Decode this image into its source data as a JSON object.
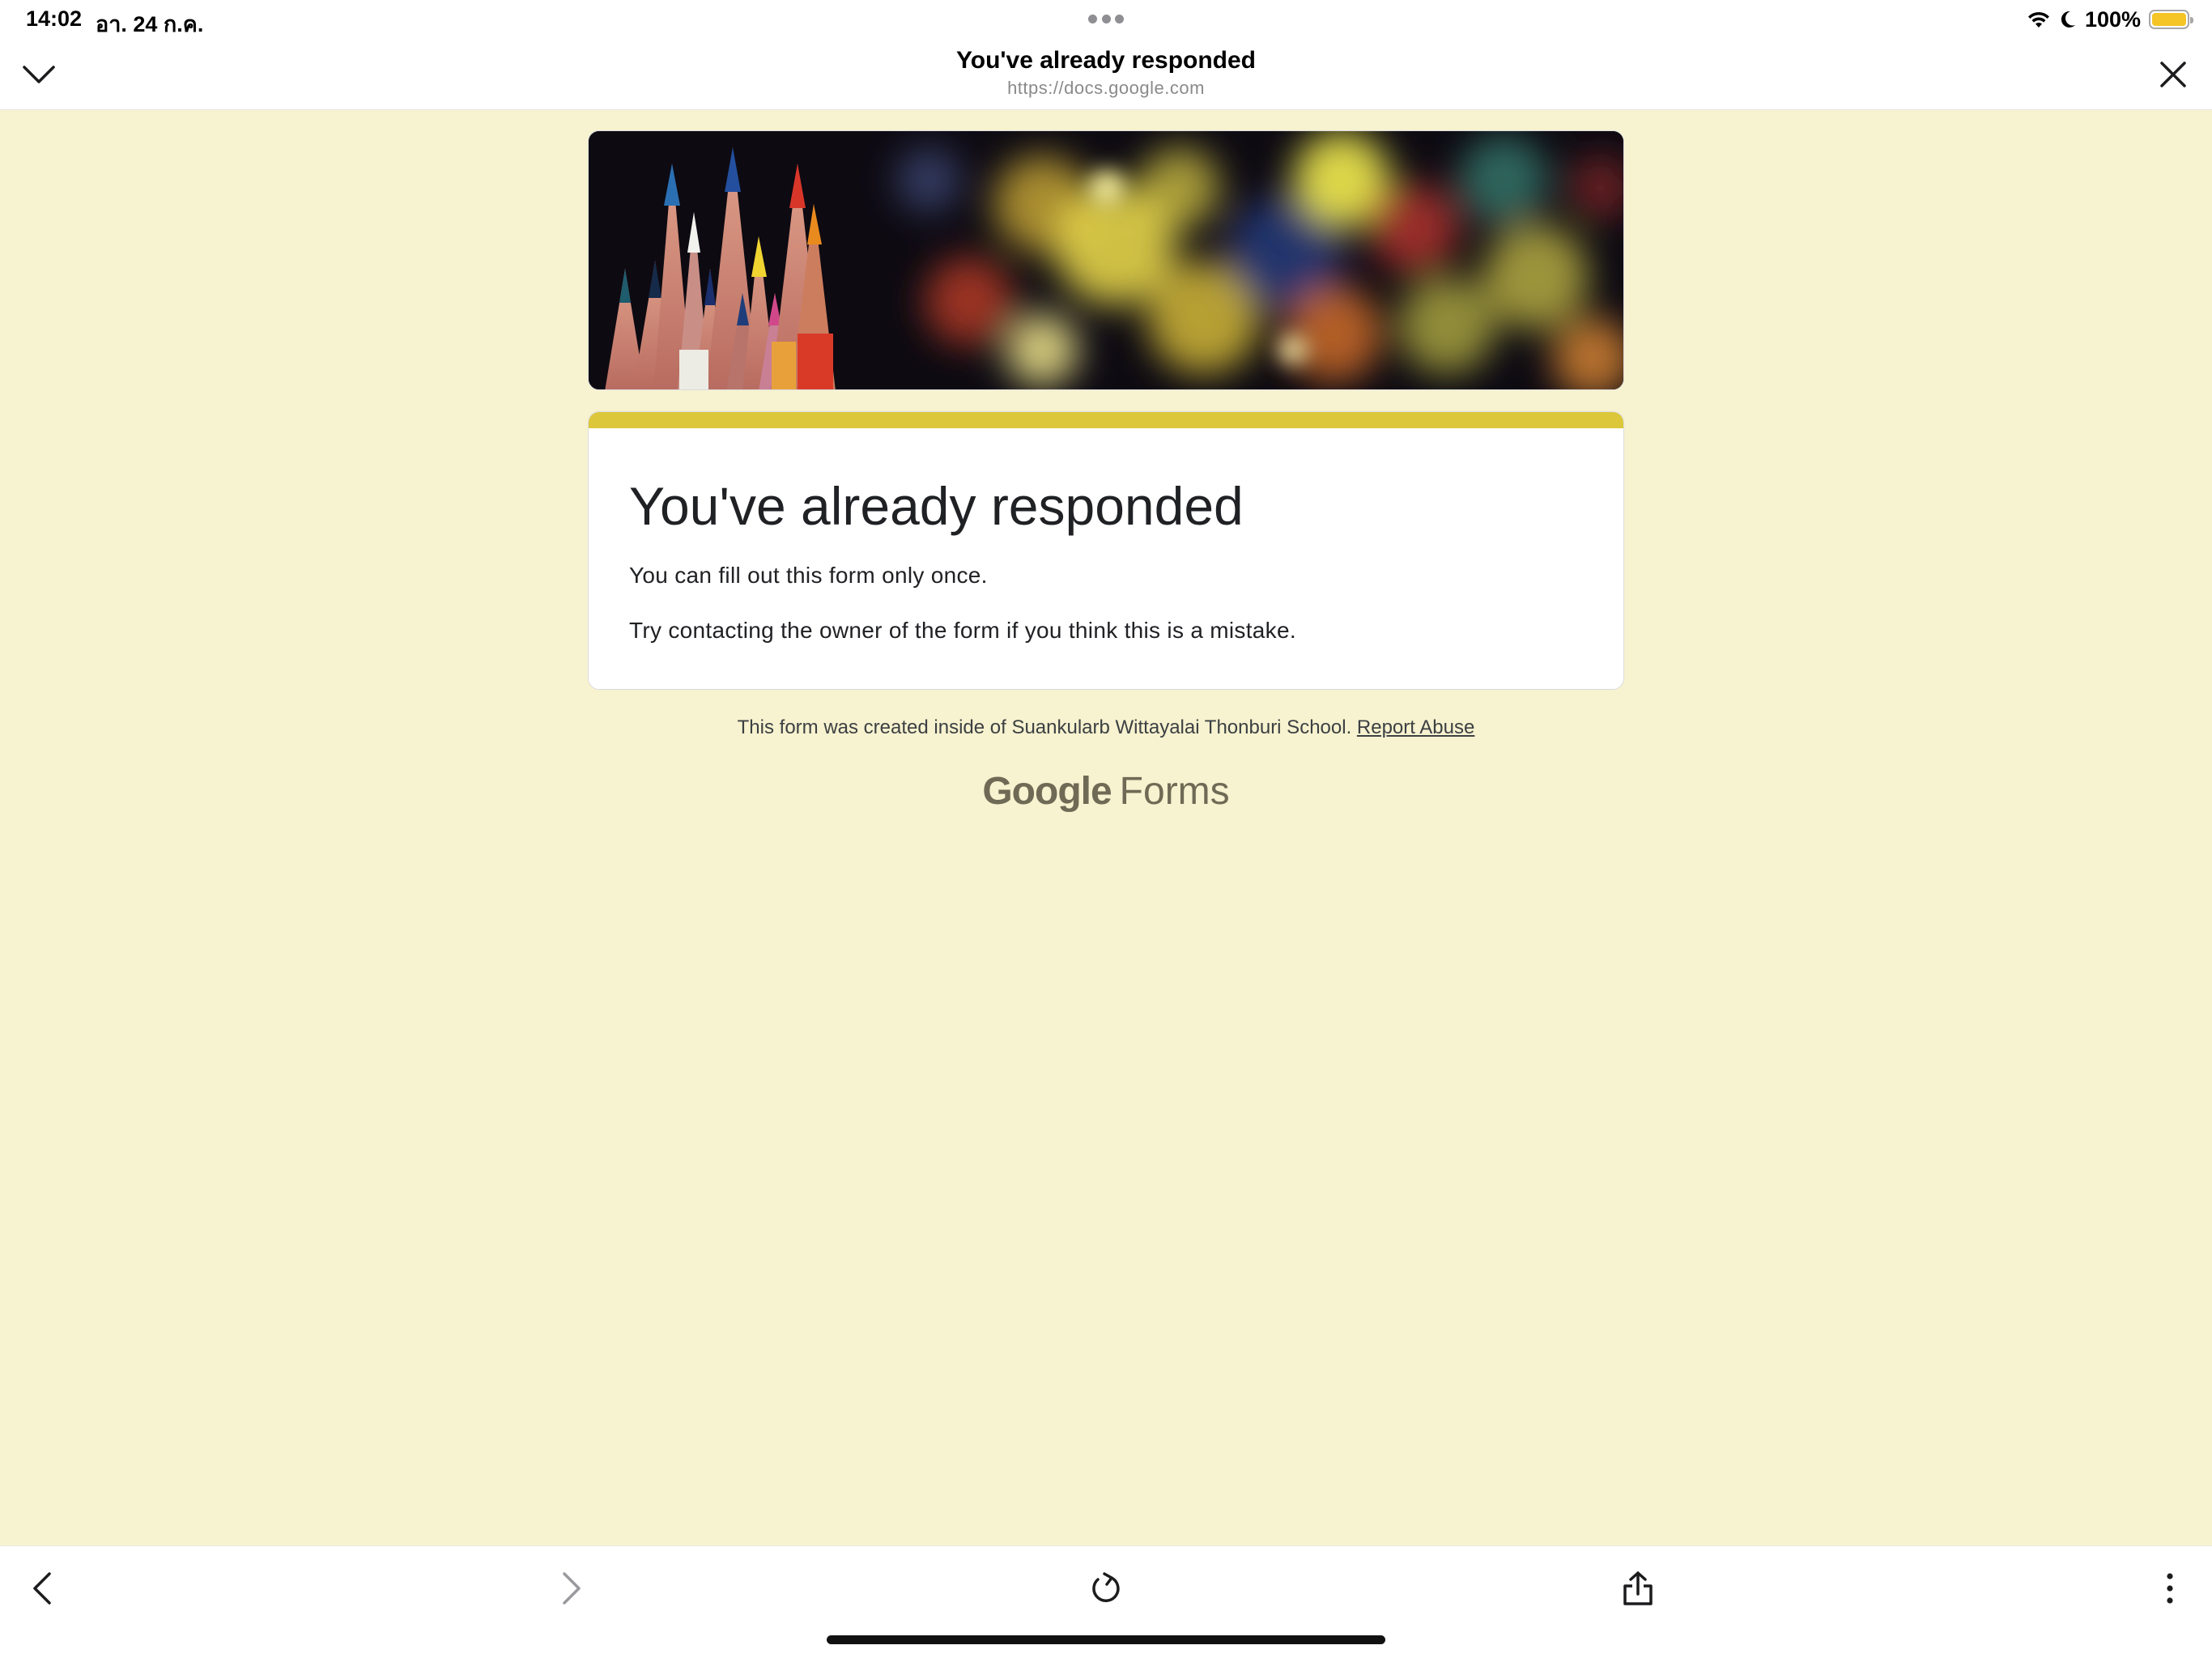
{
  "status_bar": {
    "time": "14:02",
    "date": "อา. 24 ก.ค.",
    "battery": "100%",
    "battery_level": 1.0,
    "battery_color": "#f5c425"
  },
  "browser": {
    "title": "You've already responded",
    "url": "https://docs.google.com",
    "icons": {
      "collapse": "chevron-down-icon",
      "close": "close-icon",
      "back": "chevron-left-icon",
      "forward": "chevron-right-icon",
      "reload": "reload-icon",
      "share": "share-icon",
      "more": "more-vertical-icon"
    }
  },
  "form": {
    "accent_color": "#dcc73b",
    "background_color": "#f7f2cf",
    "title": "You've already responded",
    "line1": "You can fill out this form only once.",
    "line2": "Try contacting the owner of the form if you think this is a mistake."
  },
  "footer": {
    "note": "This form was created inside of Suankularb Wittayalai Thonburi School.",
    "report_link": "Report Abuse",
    "brand_google": "Google",
    "brand_forms": "Forms"
  }
}
